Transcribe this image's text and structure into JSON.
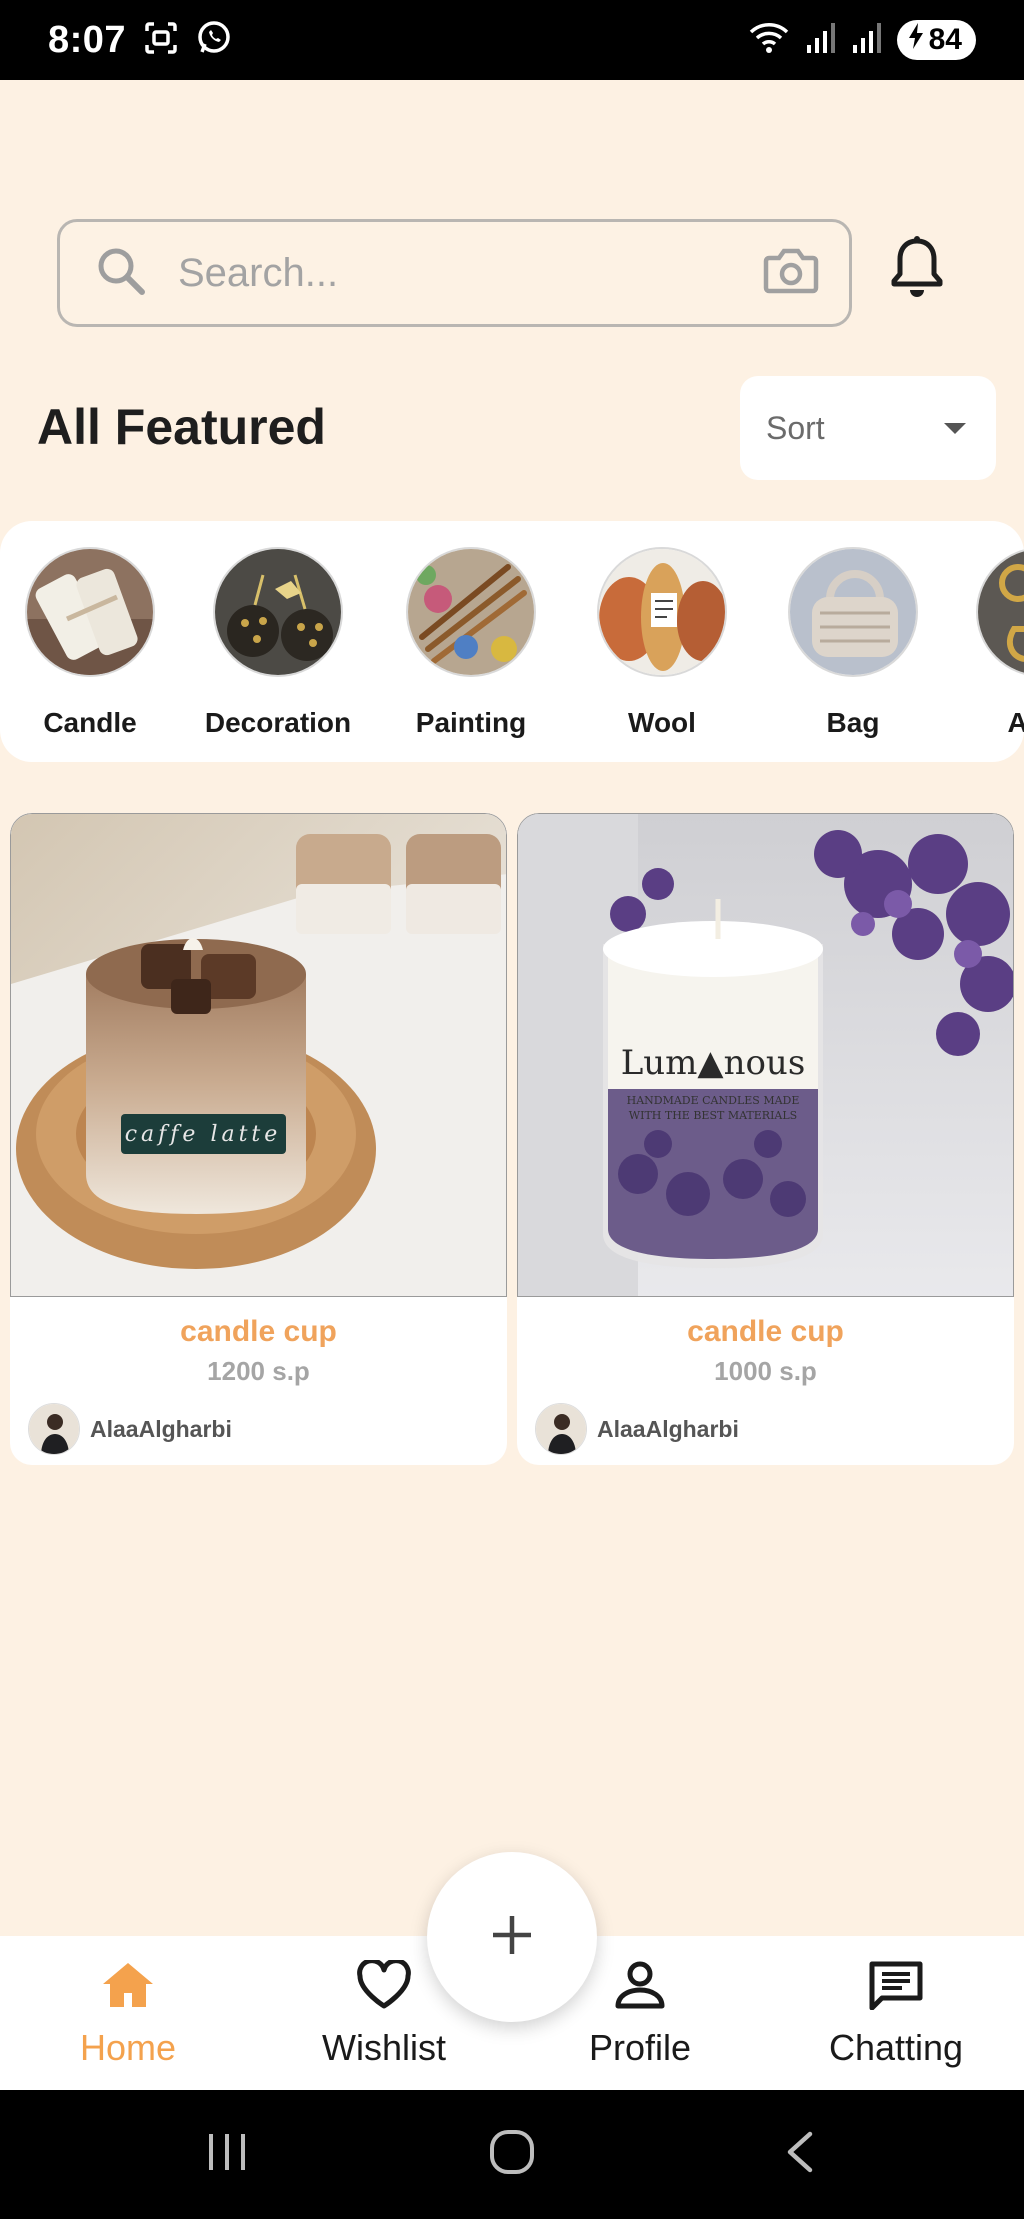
{
  "status_bar": {
    "time": "8:07",
    "battery": "84",
    "icons": [
      "screenshot-icon",
      "whatsapp-icon",
      "wifi-icon",
      "signal-icon",
      "signal-icon",
      "battery-charging-icon"
    ]
  },
  "search": {
    "placeholder": "Search...",
    "value": ""
  },
  "header": {
    "title": "All Featured",
    "sort_label": "Sort"
  },
  "categories": [
    {
      "label": "Candle"
    },
    {
      "label": "Decoration"
    },
    {
      "label": "Painting"
    },
    {
      "label": "Wool"
    },
    {
      "label": "Bag"
    },
    {
      "label": "Acce"
    }
  ],
  "products": [
    {
      "name": "candle cup",
      "price": "1200 s.p",
      "seller": "AlaaAlgharbi"
    },
    {
      "name": "candle cup",
      "price": "1000 s.p",
      "seller": "AlaaAlgharbi"
    }
  ],
  "bottom_nav": {
    "items": [
      {
        "label": "Home",
        "icon": "home-icon",
        "active": true
      },
      {
        "label": "Wishlist",
        "icon": "heart-icon",
        "active": false
      },
      {
        "label": "Profile",
        "icon": "person-icon",
        "active": false
      },
      {
        "label": "Chatting",
        "icon": "chat-icon",
        "active": false
      }
    ],
    "fab_icon": "plus-icon"
  },
  "colors": {
    "background": "#fdf1e3",
    "accent": "#f4a24d",
    "product_name": "#f0a35c",
    "price": "#a5a5a5"
  }
}
